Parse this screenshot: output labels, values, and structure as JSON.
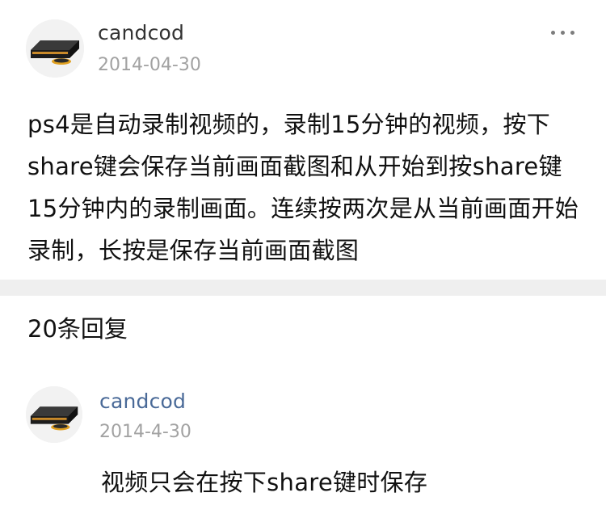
{
  "post": {
    "username": "candcod",
    "date": "2014-04-30",
    "more_icon": "more-horizontal-icon",
    "content": "ps4是自动录制视频的，录制15分钟的视频，按下share键会保存当前画面截图和从开始到按share键15分钟内的录制画面。连续按两次是从当前画面开始录制，长按是保存当前画面截图"
  },
  "replies": {
    "count_label": "20条回复",
    "items": [
      {
        "username": "candcod",
        "date": "2014-4-30",
        "text": "视频只会在按下share键时保存"
      }
    ]
  },
  "colors": {
    "reply_username": "#4a6a98",
    "meta_gray": "#a2a2a2",
    "divider": "#efefef"
  }
}
